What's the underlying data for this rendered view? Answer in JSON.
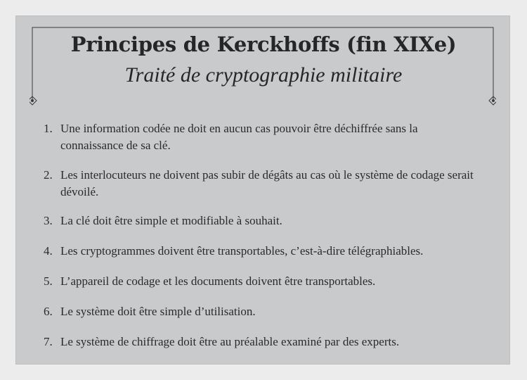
{
  "header": {
    "title": "Principes de Kerckhoffs (fin XIXe)",
    "subtitle": "Traité de cryptographie militaire"
  },
  "principles": [
    {
      "number": "1.",
      "text": "Une information codée ne doit en aucun cas pouvoir être déchiffrée sans la connaissance de sa clé."
    },
    {
      "number": "2.",
      "text": "Les interlocuteurs ne doivent pas subir de dégâts au cas où le système de codage serait dévoilé."
    },
    {
      "number": "3.",
      "text": "La clé doit être simple et modifiable à souhait."
    },
    {
      "number": "4.",
      "text": "Les cryptogrammes doivent être transportables, c’est-à-dire télégraphiables."
    },
    {
      "number": "5.",
      "text": "L’appareil de codage et les documents doivent être transportables."
    },
    {
      "number": "6.",
      "text": "Le système doit être simple d’utilisation."
    },
    {
      "number": "7.",
      "text": "Le système de chiffrage doit être au préalable examiné par des experts."
    }
  ],
  "colors": {
    "page_background": "#ececec",
    "card_background": "#c9cacc",
    "text": "#2a2a2a"
  }
}
